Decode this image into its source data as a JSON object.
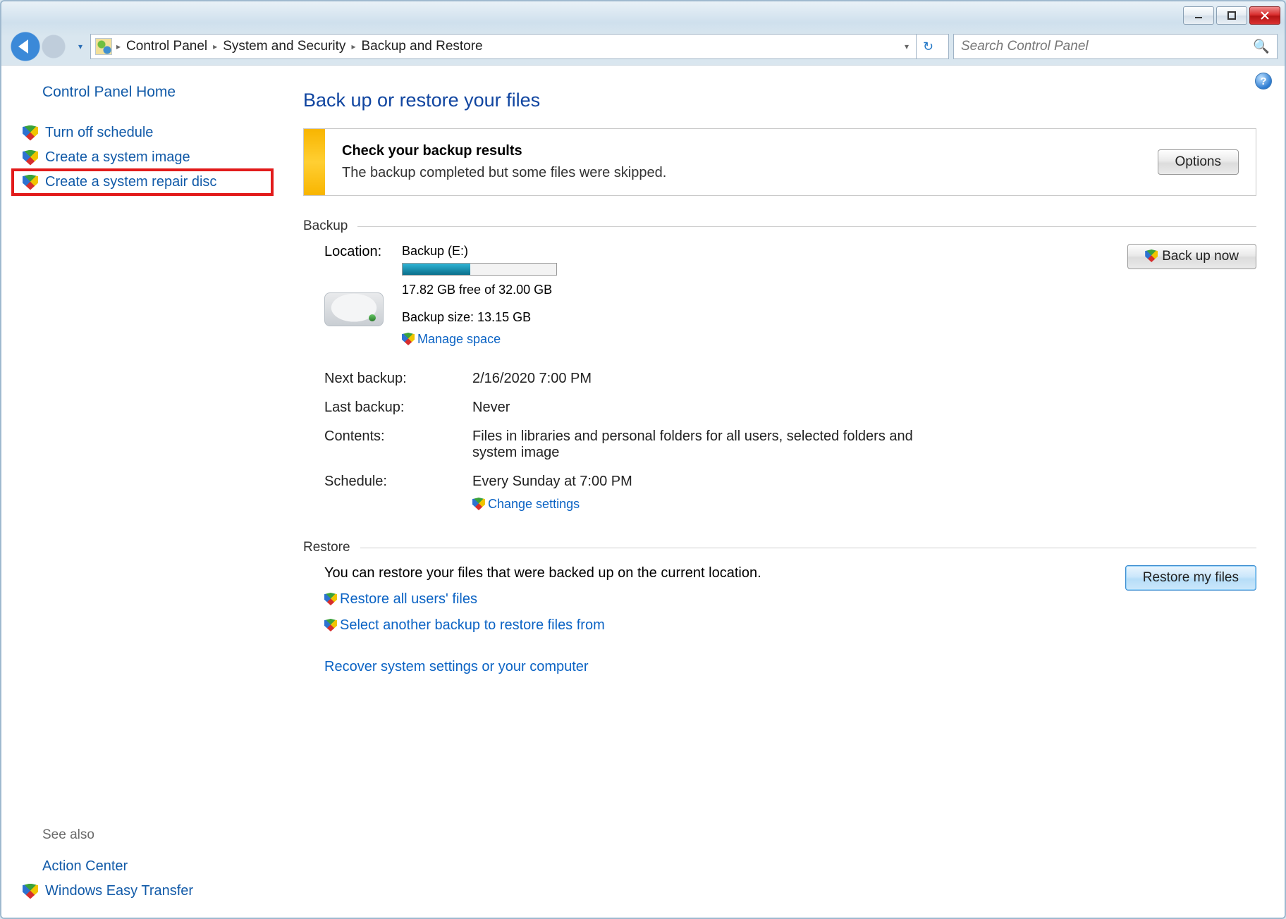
{
  "breadcrumb": {
    "seg1": "Control Panel",
    "seg2": "System and Security",
    "seg3": "Backup and Restore"
  },
  "search": {
    "placeholder": "Search Control Panel"
  },
  "sidebar": {
    "home": "Control Panel Home",
    "tasks": {
      "turn_off": "Turn off schedule",
      "create_image": "Create a system image",
      "create_repair": "Create a system repair disc"
    },
    "see_also_label": "See also",
    "see_also": {
      "action_center": "Action Center",
      "easy_transfer": "Windows Easy Transfer"
    }
  },
  "main": {
    "title": "Back up or restore your files",
    "results": {
      "heading": "Check your backup results",
      "sub": "The backup completed but some files were skipped.",
      "options_btn": "Options"
    },
    "backup": {
      "section": "Backup",
      "backup_now_btn": "Back up now",
      "location_label": "Location:",
      "location_value": "Backup (E:)",
      "free_text": "17.82 GB free of 32.00 GB",
      "progress_pct": 44,
      "size_text": "Backup size: 13.15 GB",
      "manage_space": "Manage space",
      "next_label": "Next backup:",
      "next_value": "2/16/2020 7:00 PM",
      "last_label": "Last backup:",
      "last_value": "Never",
      "contents_label": "Contents:",
      "contents_value": "Files in libraries and personal folders for all users, selected folders and system image",
      "schedule_label": "Schedule:",
      "schedule_value": "Every Sunday at 7:00 PM",
      "change_settings": "Change settings"
    },
    "restore": {
      "section": "Restore",
      "blurb": "You can restore your files that were backed up on the current location.",
      "restore_all": "Restore all users' files",
      "select_another": "Select another backup to restore files from",
      "recover_system": "Recover system settings or your computer",
      "restore_btn": "Restore my files"
    }
  }
}
